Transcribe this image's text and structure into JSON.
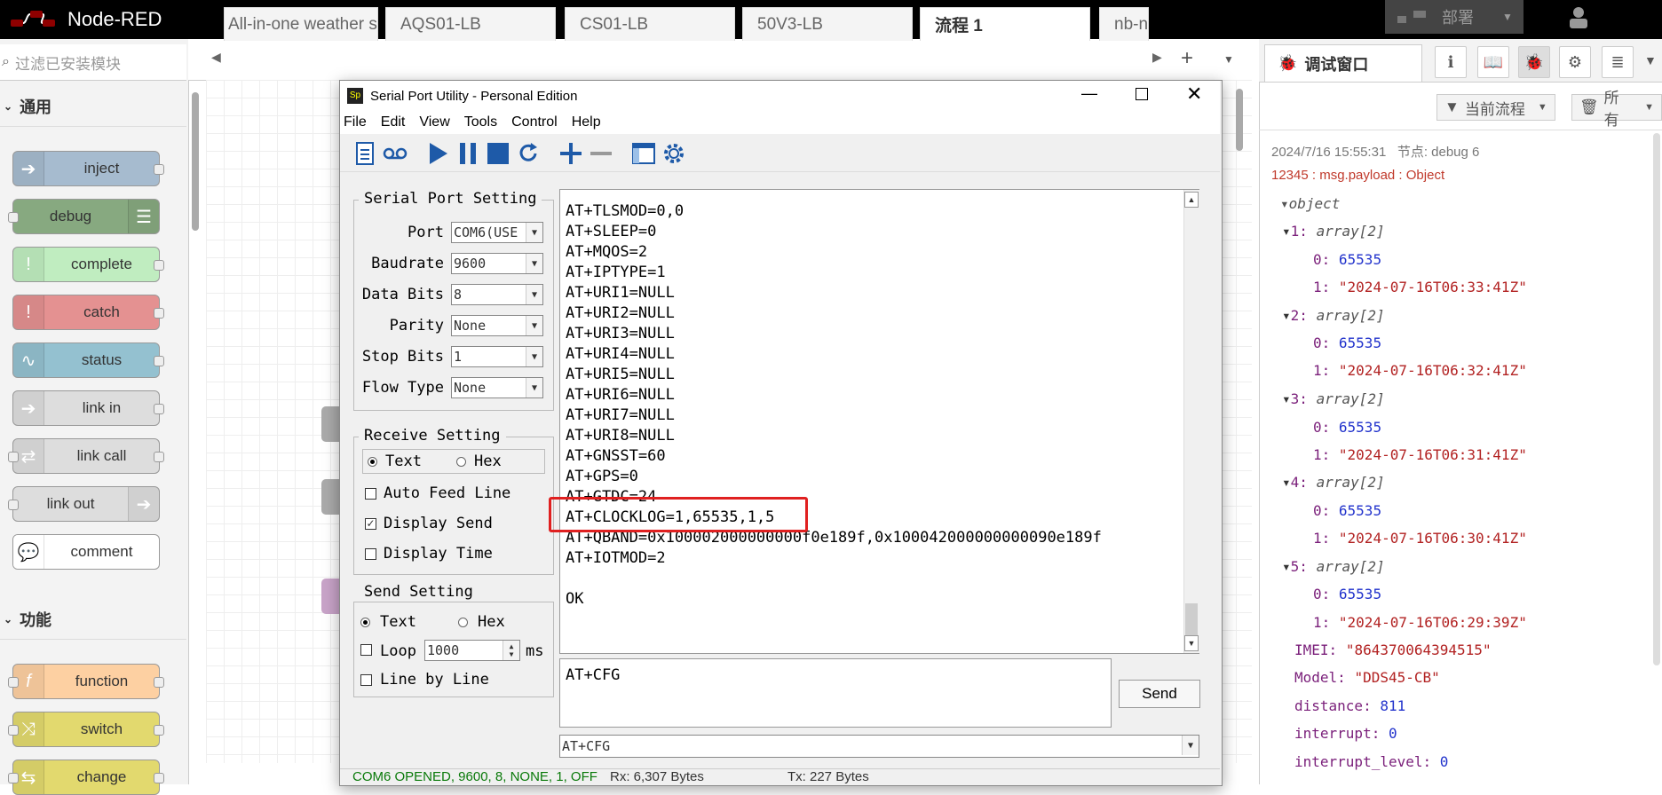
{
  "header": {
    "app_title": "Node-RED",
    "deploy_label": "部署"
  },
  "palette": {
    "search_placeholder": "过滤已安装模块",
    "categories": [
      {
        "label": "通用"
      },
      {
        "label": "功能"
      }
    ],
    "nodes": [
      {
        "label": "inject",
        "color": "#a6bbcf"
      },
      {
        "label": "debug",
        "color": "#87a980"
      },
      {
        "label": "complete",
        "color": "#c0edc0"
      },
      {
        "label": "catch",
        "color": "#e49191"
      },
      {
        "label": "status",
        "color": "#94c1d0"
      },
      {
        "label": "link in",
        "color": "#dddddd"
      },
      {
        "label": "link call",
        "color": "#dddddd"
      },
      {
        "label": "link out",
        "color": "#dddddd"
      },
      {
        "label": "comment",
        "color": "#ffffff"
      },
      {
        "label": "function",
        "color": "#fdd0a2"
      },
      {
        "label": "switch",
        "color": "#e2d96e"
      },
      {
        "label": "change",
        "color": "#e2d96e"
      }
    ]
  },
  "tabs": [
    "All-in-one weather s",
    "AQS01-LB",
    "CS01-LB",
    "50V3-LB",
    "流程 1",
    "nb-n"
  ],
  "active_tab": "流程 1",
  "sidebar": {
    "title": "调试窗口",
    "filter_label": "当前流程",
    "clear_label": "所有",
    "message": {
      "timestamp": "2024/7/16 15:55:31",
      "node": "节点: debug 6",
      "topic_line": "12345 : msg.payload : Object",
      "root": "object",
      "entries": [
        {
          "key": "1",
          "type": "array[2]",
          "v0": "65535",
          "v1": "\"2024-07-16T06:33:41Z\""
        },
        {
          "key": "2",
          "type": "array[2]",
          "v0": "65535",
          "v1": "\"2024-07-16T06:32:41Z\""
        },
        {
          "key": "3",
          "type": "array[2]",
          "v0": "65535",
          "v1": "\"2024-07-16T06:31:41Z\""
        },
        {
          "key": "4",
          "type": "array[2]",
          "v0": "65535",
          "v1": "\"2024-07-16T06:30:41Z\""
        },
        {
          "key": "5",
          "type": "array[2]",
          "v0": "65535",
          "v1": "\"2024-07-16T06:29:39Z\""
        }
      ],
      "fields": [
        {
          "key": "IMEI",
          "value": "\"864370064394515\"",
          "kind": "str"
        },
        {
          "key": "Model",
          "value": "\"DDS45-CB\"",
          "kind": "str"
        },
        {
          "key": "distance",
          "value": "811",
          "kind": "num"
        },
        {
          "key": "interrupt",
          "value": "0",
          "kind": "num"
        },
        {
          "key": "interrupt_level",
          "value": "0",
          "kind": "num"
        }
      ]
    }
  },
  "serial": {
    "title": "Serial Port Utility - Personal Edition",
    "menu": [
      "File",
      "Edit",
      "View",
      "Tools",
      "Control",
      "Help"
    ],
    "port_setting": {
      "title": "Serial Port Setting",
      "port_label": "Port",
      "port_value": "COM6(USE",
      "baud_label": "Baudrate",
      "baud_value": "9600",
      "databits_label": "Data Bits",
      "databits_value": "8",
      "parity_label": "Parity",
      "parity_value": "None",
      "stopbits_label": "Stop Bits",
      "stopbits_value": "1",
      "flow_label": "Flow Type",
      "flow_value": "None"
    },
    "receive_setting": {
      "title": "Receive Setting",
      "text": "Text",
      "hex": "Hex",
      "auto_feed": "Auto Feed Line",
      "display_send": "Display Send",
      "display_time": "Display Time"
    },
    "send_setting": {
      "title": "Send Setting",
      "text": "Text",
      "hex": "Hex",
      "loop": "Loop",
      "loop_value": "1000",
      "ms": "ms",
      "line_by_line": "Line by Line"
    },
    "terminal_lines": [
      "AT+TLSMOD=0,0",
      "AT+SLEEP=0",
      "AT+MQOS=2",
      "AT+IPTYPE=1",
      "AT+URI1=NULL",
      "AT+URI2=NULL",
      "AT+URI3=NULL",
      "AT+URI4=NULL",
      "AT+URI5=NULL",
      "AT+URI6=NULL",
      "AT+URI7=NULL",
      "AT+URI8=NULL",
      "AT+GNSST=60",
      "AT+GPS=0",
      "AT+GTDC=24",
      "AT+CLOCKLOG=1,65535,1,5",
      "AT+QBAND=0x100002000000000f0e189f,0x100042000000000090e189f",
      "AT+IOTMOD=2",
      "",
      "OK"
    ],
    "send_text": "AT+CFG",
    "send_button": "Send",
    "history_value": "AT+CFG",
    "status": {
      "port": "COM6 OPENED, 9600, 8, NONE, 1, OFF",
      "rx": "Rx: 6,307 Bytes",
      "tx": "Tx: 227 Bytes"
    }
  }
}
